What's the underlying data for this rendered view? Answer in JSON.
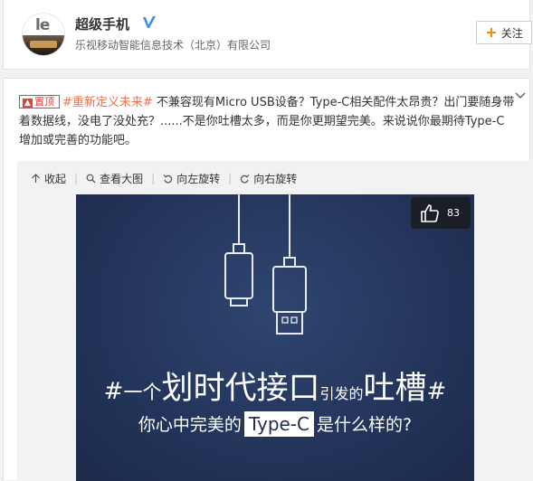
{
  "profile": {
    "name": "超级手机",
    "company": "乐视移动智能信息技术（北京）有限公司",
    "avatar_logo": "le",
    "follow_label": "关注"
  },
  "post": {
    "pin_label": "置顶",
    "topic": "#重新定义未来#",
    "text": " 不兼容现有Micro USB设备？Type-C相关配件太昂贵？出门要随身带着数据线，没电了没处充？......不是你吐槽太多，而是你更期望完美。来说说你最期待Type-C增加或完善的功能吧。"
  },
  "media_toolbar": {
    "collapse": "收起",
    "view_large": "查看大图",
    "rotate_left": "向左旋转",
    "rotate_right": "向右旋转"
  },
  "image": {
    "like_count": "83",
    "headline": {
      "hash_start": "#",
      "part1": "一个",
      "part2": "划时代接口",
      "part3": "引发的",
      "part4": "吐槽",
      "hash_end": "#"
    },
    "subline": {
      "before": "你心中完美的",
      "highlight": "Type-C",
      "after": "是什么样的?"
    }
  },
  "colors": {
    "accent": "#ff8200",
    "topic": "#eb7350",
    "pin": "#e2433b",
    "image_bg": "#23345a"
  }
}
